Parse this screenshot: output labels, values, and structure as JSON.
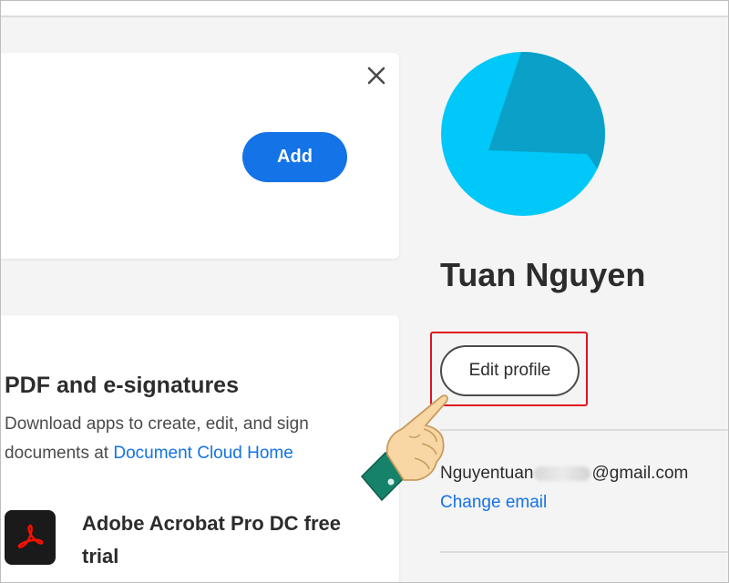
{
  "dialog": {
    "close_icon": "close-icon",
    "add_label": "Add"
  },
  "apps_section": {
    "title": "PDF and e-signatures",
    "description": "Download apps to create, edit, and sign documents at ",
    "link_text": "Document Cloud Home",
    "app_icon": "acrobat-icon",
    "app_title": "Adobe Acrobat Pro DC free trial"
  },
  "profile": {
    "avatar_icon": "avatar",
    "name": "Tuan Nguyen",
    "edit_label": "Edit profile",
    "email_prefix": "Nguyentuan",
    "email_suffix": "@gmail.com",
    "change_email_label": "Change email"
  },
  "annotation": {
    "highlight_color": "#e0141e",
    "pointer_icon": "pointing-hand-icon"
  },
  "colors": {
    "accent": "#1473e6",
    "avatar_light": "#00c8f8",
    "avatar_dark": "#0aa0c8"
  }
}
